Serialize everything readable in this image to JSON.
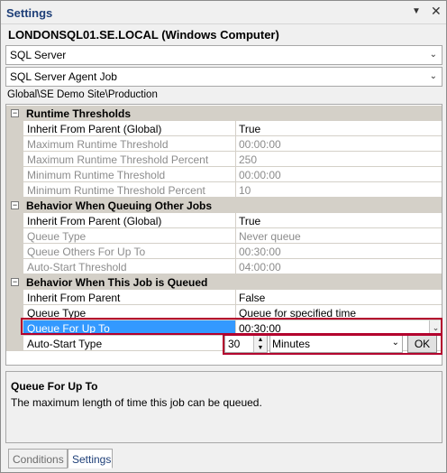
{
  "window": {
    "title": "Settings",
    "pin_icon": "pin-down-icon",
    "close_icon": "close-icon"
  },
  "server": {
    "name": "LONDONSQL01.SE.LOCAL (Windows Computer)"
  },
  "combos": [
    {
      "value": "SQL Server"
    },
    {
      "value": "SQL Server Agent Job"
    }
  ],
  "path": "Global\\SE Demo Site\\Production",
  "grid": {
    "categories": [
      {
        "label": "Runtime Thresholds",
        "toggle": "⊟"
      },
      {
        "label": "Behavior When Queuing Other Jobs",
        "toggle": "⊟"
      },
      {
        "label": "Behavior When This Job is Queued",
        "toggle": "⊟"
      }
    ],
    "rows": [
      {
        "name": "Inherit From Parent (Global)",
        "value": "True"
      },
      {
        "name": "Maximum Runtime Threshold",
        "value": "00:00:00"
      },
      {
        "name": "Maximum Runtime Threshold Percent",
        "value": "250"
      },
      {
        "name": "Minimum Runtime Threshold",
        "value": "00:00:00"
      },
      {
        "name": "Minimum Runtime Threshold Percent",
        "value": "10"
      },
      {
        "name": "Inherit From Parent (Global)",
        "value": "True"
      },
      {
        "name": "Queue Type",
        "value": "Never queue"
      },
      {
        "name": "Queue Others For Up To",
        "value": "00:30:00"
      },
      {
        "name": "Auto-Start Threshold",
        "value": "04:00:00"
      },
      {
        "name": "Inherit From Parent",
        "value": "False"
      },
      {
        "name": "Queue Type",
        "value": "Queue for specified time"
      },
      {
        "name": "Queue For Up To",
        "value": "00:30:00"
      },
      {
        "name": "Auto-Start Type",
        "value": ""
      }
    ]
  },
  "editor": {
    "spin_value": "30",
    "unit": "Minutes",
    "ok_label": "OK"
  },
  "description": {
    "title": "Queue For Up To",
    "text": "The maximum length of time this job can be queued."
  },
  "tabs": [
    {
      "label": "Conditions"
    },
    {
      "label": "Settings"
    }
  ],
  "colors": {
    "selection": "#3399ff",
    "highlight_border": "#b3002d",
    "category_bg": "#d4d0c8"
  }
}
